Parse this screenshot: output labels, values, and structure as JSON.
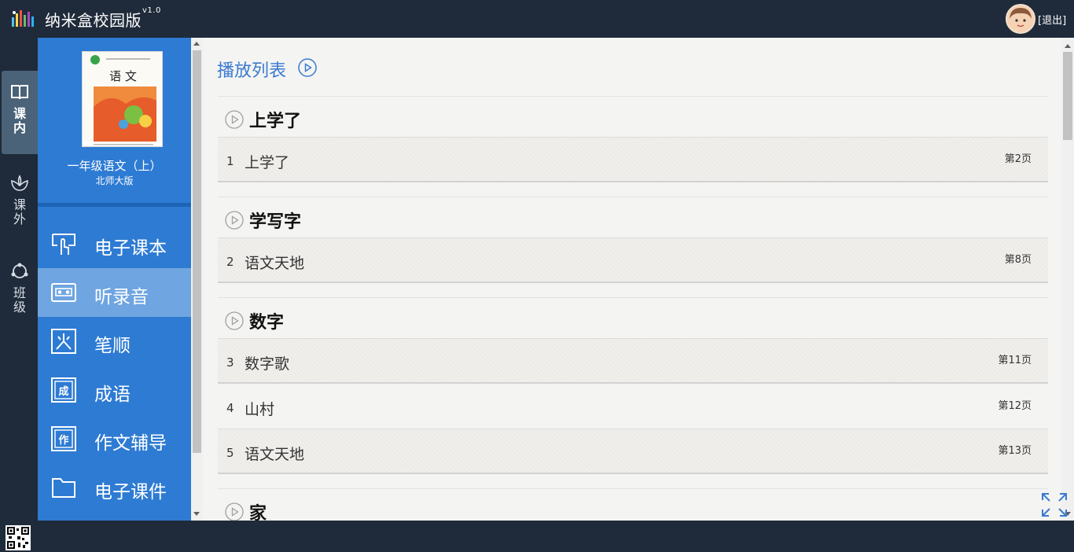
{
  "header": {
    "title": "纳米盒校园版",
    "version": "v1.0",
    "logout": "[退出]"
  },
  "leftnav": [
    {
      "label": "课内",
      "icon": "book-icon",
      "active": true
    },
    {
      "label": "课外",
      "icon": "lotus-icon",
      "active": false
    },
    {
      "label": "班级",
      "icon": "circle-group-icon",
      "active": false
    }
  ],
  "book": {
    "name": "一年级语文（上）",
    "edition": "北师大版",
    "cover_title": "语 文"
  },
  "menu": [
    {
      "label": "电子课本",
      "icon": "hand-book-icon",
      "active": false
    },
    {
      "label": "听录音",
      "icon": "cassette-icon",
      "active": true
    },
    {
      "label": "笔顺",
      "icon": "stroke-order-icon",
      "active": false
    },
    {
      "label": "成语",
      "icon": "idiom-icon",
      "active": false
    },
    {
      "label": "作文辅导",
      "icon": "essay-icon",
      "active": false
    },
    {
      "label": "电子课件",
      "icon": "folder-icon",
      "active": false
    }
  ],
  "playlist": {
    "title": "播放列表",
    "sections": [
      {
        "title": "上学了",
        "items": [
          {
            "num": "1",
            "text": "上学了",
            "page": "第2页"
          }
        ]
      },
      {
        "title": "学写字",
        "items": [
          {
            "num": "2",
            "text": "语文天地",
            "page": "第8页"
          }
        ]
      },
      {
        "title": "数字",
        "items": [
          {
            "num": "3",
            "text": "数字歌",
            "page": "第11页"
          },
          {
            "num": "4",
            "text": "山村",
            "page": "第12页"
          },
          {
            "num": "5",
            "text": "语文天地",
            "page": "第13页"
          }
        ]
      },
      {
        "title": "家",
        "items": []
      }
    ]
  },
  "colors": {
    "topbar": "#1f2b3a",
    "sidebar": "#2e7bd3",
    "active_menu": "#6fa5e1",
    "accent": "#3a7ad0"
  }
}
